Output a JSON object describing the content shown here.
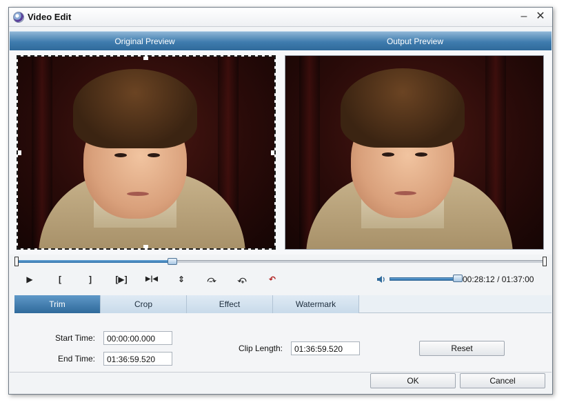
{
  "window": {
    "title": "Video Edit",
    "minimize_glyph": "–",
    "close_glyph": "✕"
  },
  "preview": {
    "original_label": "Original Preview",
    "output_label": "Output Preview"
  },
  "timeline": {
    "progress": 0.295
  },
  "controls": {
    "buttons": [
      {
        "name": "play-button",
        "glyph": "▶"
      },
      {
        "name": "set-start-button",
        "glyph": "["
      },
      {
        "name": "set-end-button",
        "glyph": "]"
      },
      {
        "name": "next-frame-button",
        "glyph": "[▶]"
      },
      {
        "name": "split-button",
        "glyph": "▶|◀"
      },
      {
        "name": "flip-vertical-button",
        "glyph": "⇕"
      },
      {
        "name": "rotate-right-button",
        "glyph": "⤼"
      },
      {
        "name": "rotate-left-button",
        "glyph": "⤽"
      },
      {
        "name": "undo-button",
        "glyph": "↶"
      }
    ],
    "volume_level": 0.95,
    "current_time": "00:28:12",
    "total_time": "01:37:00",
    "time_separator": "/"
  },
  "tabs": [
    {
      "label": "Trim",
      "active": true
    },
    {
      "label": "Crop",
      "active": false
    },
    {
      "label": "Effect",
      "active": false
    },
    {
      "label": "Watermark",
      "active": false
    }
  ],
  "trim": {
    "start_label": "Start Time:",
    "start_value": "00:00:00.000",
    "end_label": "End Time:",
    "end_value": "01:36:59.520",
    "clip_length_label": "Clip Length:",
    "clip_length_value": "01:36:59.520",
    "reset_label": "Reset"
  },
  "footer": {
    "ok_label": "OK",
    "cancel_label": "Cancel"
  },
  "colors": {
    "accent": "#2f6a9b",
    "header_top": "#8fb6d6",
    "active_tab": "#3f7cae"
  }
}
